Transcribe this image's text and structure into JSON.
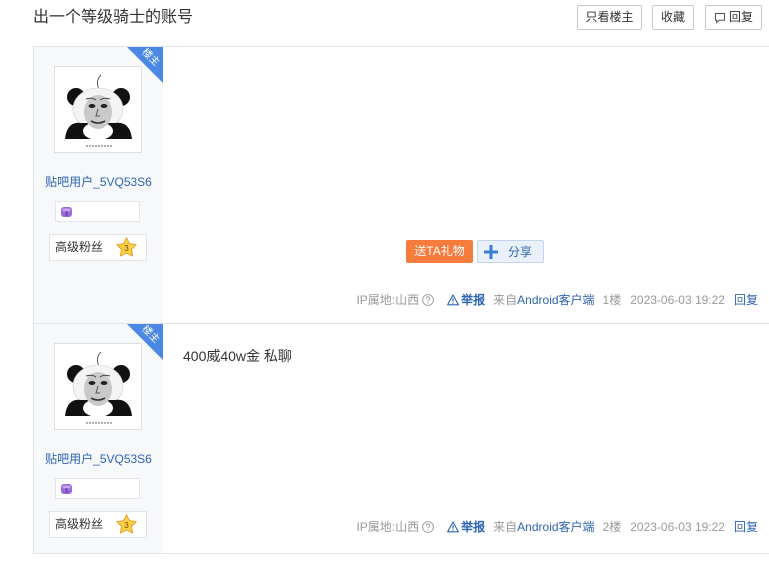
{
  "thread": {
    "title": "出一个等级骑士的账号"
  },
  "toolbar": {
    "only_author_label": "只看楼主",
    "favorite_label": "收藏",
    "reply_label": "回复"
  },
  "posts": [
    {
      "author": {
        "name": "贴吧用户_5VQ53S6",
        "op_badge": "楼主",
        "fan_title": "高级粉丝",
        "fan_level": "3"
      },
      "actions": {
        "gift_label": "送TA礼物",
        "share_label": "分享"
      },
      "tail": {
        "ip_location": "IP属地:山西",
        "report_label": "举报",
        "from_prefix": "来自",
        "client": "Android客户端",
        "floor": "1楼",
        "time": "2023-06-03 19:22",
        "reply_label": "回复"
      }
    },
    {
      "author": {
        "name": "贴吧用户_5VQ53S6",
        "op_badge": "楼主",
        "fan_title": "高级粉丝",
        "fan_level": "3"
      },
      "content": "400威40w金 私聊",
      "tail": {
        "ip_location": "IP属地:山西",
        "report_label": "举报",
        "from_prefix": "来自",
        "client": "Android客户端",
        "floor": "2楼",
        "time": "2023-06-03 19:22",
        "reply_label": "回复"
      }
    }
  ],
  "icons": {
    "avatar": "panda-meme-avatar",
    "member_badge": "member-badge-icon",
    "fan_level": "star-level-icon",
    "ip_help": "help-circle-icon",
    "report": "warning-icon",
    "share": "plus-icon",
    "reply": "reply-icon"
  },
  "colors": {
    "link": "#2d64b3",
    "gift_button": "#f77b3c",
    "op_badge": "#4a88e3",
    "tail_text": "#999999",
    "sidebar_bg": "#f7f8fa",
    "border": "#e1e4e6",
    "star": "#fbd243"
  }
}
